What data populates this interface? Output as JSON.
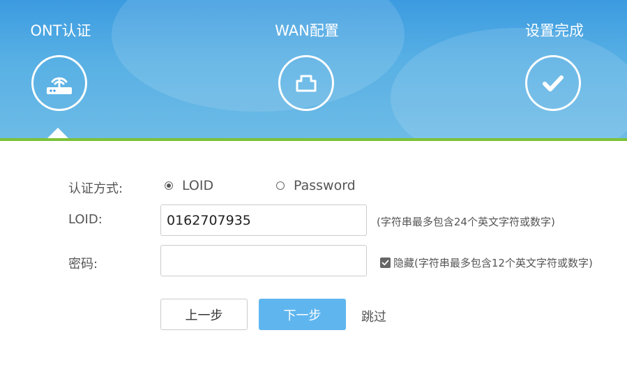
{
  "steps": [
    {
      "label": "ONT认证",
      "icon": "router-icon",
      "active": true
    },
    {
      "label": "WAN配置",
      "icon": "network-port-icon",
      "active": false
    },
    {
      "label": "设置完成",
      "icon": "checkmark-icon",
      "active": false
    }
  ],
  "colors": {
    "header_blue": "#4aa8e2",
    "accent_green": "#7cc237",
    "button_blue": "#5fb6ef"
  },
  "form": {
    "auth_method": {
      "label": "认证方式:",
      "options": [
        "LOID",
        "Password"
      ],
      "selected": "LOID"
    },
    "loid": {
      "label": "LOID:",
      "value": "0162707935",
      "hint": "(字符串最多包含24个英文字符或数字)"
    },
    "password": {
      "label": "密码:",
      "value": "",
      "hide_label": "隐藏(字符串最多包含12个英文字符或数字)",
      "hide_checked": true
    }
  },
  "buttons": {
    "prev": "上一步",
    "next": "下一步",
    "skip": "跳过"
  }
}
